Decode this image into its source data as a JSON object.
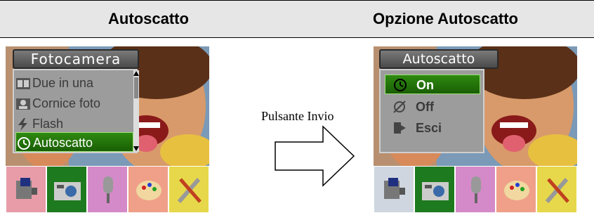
{
  "headers": {
    "left": "Autoscatto",
    "right": "Opzione Autoscatto"
  },
  "left_screen": {
    "menu_title": "Fotocamera",
    "items": [
      {
        "label": "Due in una",
        "icon": "two-in-one-icon"
      },
      {
        "label": "Cornice foto",
        "icon": "photo-frame-icon"
      },
      {
        "label": "Flash",
        "icon": "flash-icon"
      },
      {
        "label": "Autoscatto",
        "icon": "self-timer-icon",
        "selected": true
      }
    ],
    "toolbar": [
      "camcorder-icon",
      "camera-icon",
      "microphone-icon",
      "palette-icon",
      "tools-icon"
    ],
    "toolbar_selected": 1
  },
  "arrow": {
    "label": "Pulsante Invio"
  },
  "right_screen": {
    "menu_title": "Autoscatto",
    "items": [
      {
        "label": "On",
        "icon": "self-timer-icon",
        "selected": true
      },
      {
        "label": "Off",
        "icon": "self-timer-off-icon"
      },
      {
        "label": "Esci",
        "icon": "exit-icon"
      }
    ],
    "toolbar": [
      "camcorder-icon",
      "camera-icon",
      "microphone-icon",
      "palette-icon",
      "tools-icon"
    ],
    "toolbar_selected": 1
  },
  "colors": {
    "header_bg": "#e6e6e6",
    "selection_green": "#2e8a10",
    "menu_gray": "#9c9c9c"
  }
}
